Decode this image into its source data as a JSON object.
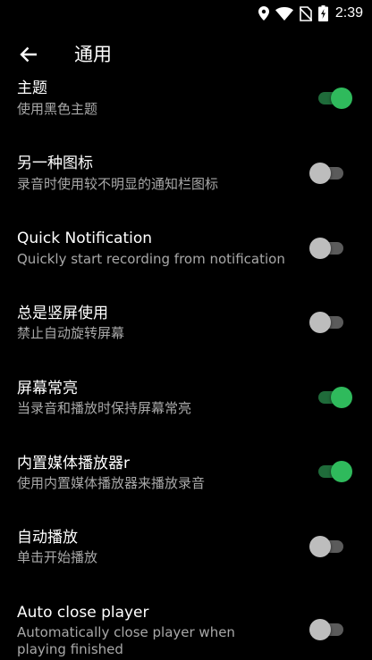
{
  "status_bar": {
    "time": "2:39",
    "icons": [
      "location-icon",
      "wifi-icon",
      "no-sim-icon",
      "battery-charging-icon"
    ]
  },
  "app_bar": {
    "back_icon": "arrow-left-icon",
    "title": "通用"
  },
  "settings": [
    {
      "id": "theme",
      "title": "主题",
      "summary": "使用黑色主题",
      "enabled": true
    },
    {
      "id": "alt-icon",
      "title": "另一种图标",
      "summary": "录音时使用较不明显的通知栏图标",
      "enabled": false
    },
    {
      "id": "quick-notification",
      "title": "Quick Notification",
      "summary": "Quickly start recording from notification",
      "enabled": false
    },
    {
      "id": "portrait",
      "title": "总是竖屏使用",
      "summary": "禁止自动旋转屏幕",
      "enabled": false
    },
    {
      "id": "screen-on",
      "title": "屏幕常亮",
      "summary": "当录音和播放时保持屏幕常亮",
      "enabled": true
    },
    {
      "id": "builtin-player",
      "title": "内置媒体播放器r",
      "summary": "使用内置媒体播放器来播放录音",
      "enabled": true
    },
    {
      "id": "autoplay",
      "title": "自动播放",
      "summary": "单击开始播放",
      "enabled": false
    },
    {
      "id": "auto-close-player",
      "title": "Auto close player",
      "summary": "Automatically close player when playing finished",
      "enabled": false
    }
  ],
  "colors": {
    "background": "#000000",
    "accent": "#2fba5c",
    "accent_track": "#1f6b3a",
    "switch_off_thumb": "#bdbdbd",
    "switch_off_track": "#5b5b5b",
    "summary_text": "#a8a8a8"
  }
}
